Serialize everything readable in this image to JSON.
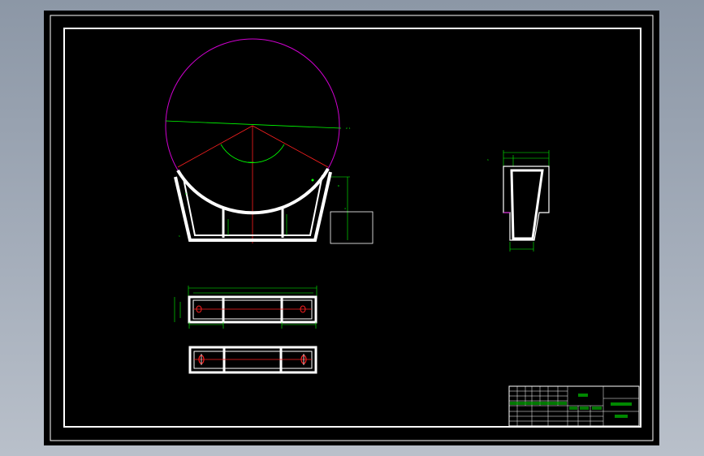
{
  "colors": {
    "background": "#000000",
    "frame": "#ffffff",
    "dimension": "#00ff00",
    "centerline": "#ff2020",
    "circle": "#d000d0",
    "screen": "#97a2b0"
  },
  "drawing": {
    "dimension_labels": {
      "top_width": "",
      "top_sub": "",
      "side_height": ""
    },
    "title_block": {
      "part_name": "",
      "drawing_number": "",
      "company": ""
    }
  }
}
